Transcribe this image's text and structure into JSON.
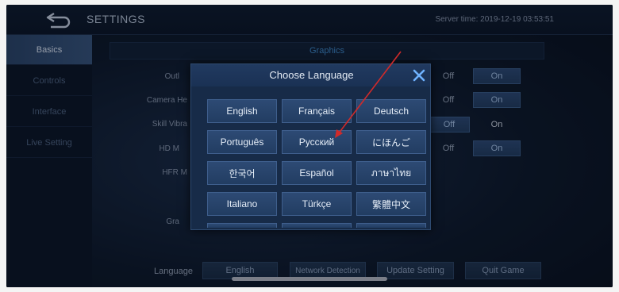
{
  "header": {
    "title": "SETTINGS",
    "server_time": "Server time: 2019-12-19 03:53:51"
  },
  "sidebar": {
    "items": [
      {
        "label": "Basics",
        "active": true
      },
      {
        "label": "Controls",
        "active": false
      },
      {
        "label": "Interface",
        "active": false
      },
      {
        "label": "Live Setting",
        "active": false
      }
    ]
  },
  "section": {
    "title": "Graphics"
  },
  "settings": {
    "labels": [
      "Outl",
      "Camera He",
      "Skill Vibra",
      "HD M",
      "HFR M",
      "Gra"
    ],
    "toggles": [
      {
        "off": "Off",
        "on": "On",
        "selected": "on"
      },
      {
        "off": "Off",
        "on": "On",
        "selected": "on"
      },
      {
        "off": "Off",
        "on": "On",
        "selected": "off"
      },
      {
        "off": "Off",
        "on": "On",
        "selected": "on"
      }
    ]
  },
  "bottom": {
    "language_label": "Language",
    "language_value": "English",
    "network_detection": "Network Detection",
    "update_setting": "Update Setting",
    "quit_game": "Quit Game"
  },
  "modal": {
    "title": "Choose Language",
    "languages": [
      "English",
      "Français",
      "Deutsch",
      "Português",
      "Русский",
      "にほんご",
      "한국어",
      "Español",
      "ภาษาไทย",
      "Italiano",
      "Türkçe",
      "繁體中文"
    ]
  },
  "colors": {
    "accent_blue": "#3f8bc9",
    "annotation_arrow": "#d12a2a",
    "close_icon": "#6fb3ff"
  }
}
